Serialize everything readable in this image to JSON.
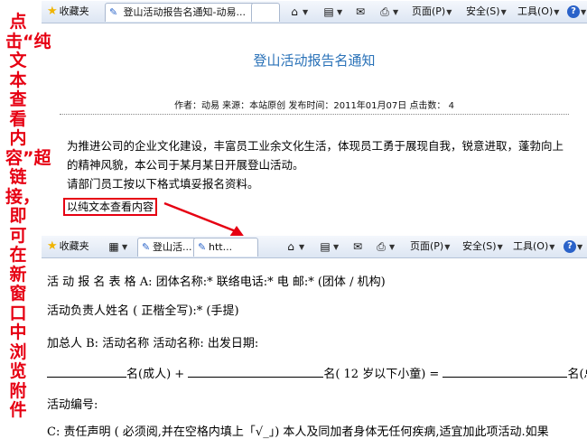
{
  "annotation": {
    "text": "点击“纯文本查看内容”超链接，即可在新窗口中浏览附件"
  },
  "toolbar_top": {
    "favorites": "收藏夹",
    "tab_title": "登山活动报告名通知-动易...",
    "menu_page": "页面(P)",
    "menu_safety": "安全(S)",
    "menu_tools": "工具(O)"
  },
  "article": {
    "title": "登山活动报告名通知",
    "meta": "作者：动易   来源：本站原创   发布时间：2011年01月07日   点击数：  4",
    "paragraph1": "为推进公司的企业文化建设，丰富员工业余文化生活，体现员工勇于展现自我，锐意进取，蓬勃向上的精神风貌，本公司于某月某日开展登山活动。",
    "paragraph2": "请部门员工按以下格式填妥报名资料。",
    "plain_text_link": "以纯文本查看内容"
  },
  "toolbar_bottom": {
    "favorites": "收藏夹",
    "tab1": "登山活...",
    "tab2": "htt...",
    "menu_page": "页面(P)",
    "menu_safety": "安全(S)",
    "menu_tools": "工具(O)"
  },
  "plain_text": {
    "line1": "活 动 报 名 表 格 A: 团体名称:* 联络电话:* 电 邮:* (团体 / 机构)",
    "line2": "活动负责人姓名 ( 正楷全写):* (手提)",
    "line3": "加总人 B: 活动名称 活动名称: 出发日期:",
    "line4_a": "名(成人) +",
    "line4_b": "名( 12 岁以下小童) =",
    "line4_c": "名(总人)",
    "line5": "活动编号:",
    "line6": "C: 责任声明 ( 必须阅,并在空格内填上「√_」) 本人及同加者身体无任何疾病,适宜加此项活动.如果"
  },
  "colors": {
    "annotation_red": "#e60012",
    "title_blue": "#2a72b8"
  }
}
